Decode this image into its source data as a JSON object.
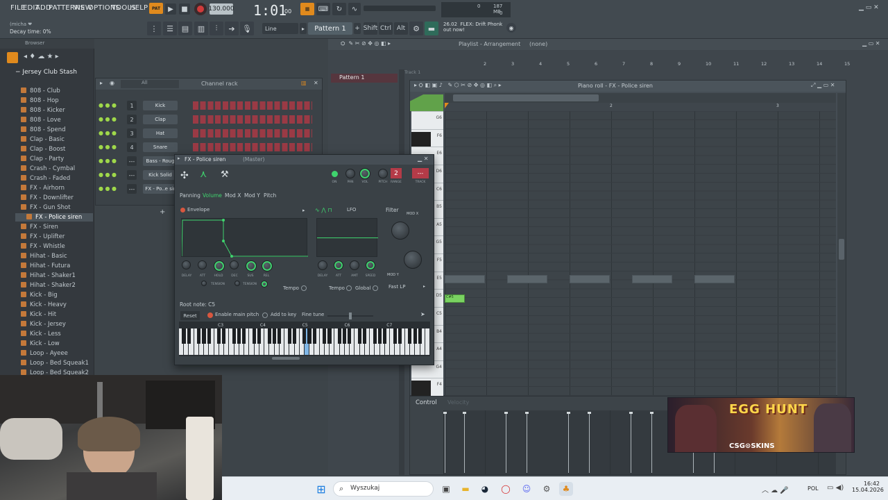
{
  "menu": [
    "FILE",
    "EDIT",
    "ADD",
    "PATTERNS",
    "VIEW",
    "OPTIONS",
    "TOOLS",
    "HELP"
  ],
  "transport": {
    "mode": "PAT",
    "tempo": "130.000",
    "time": "1:01",
    "time_sub": "00",
    "time_label": "B:S:T"
  },
  "hint": {
    "line1": "(micha ❤",
    "line2": "Decay time: 0%"
  },
  "snap": "Line",
  "pattern": "Pattern 1",
  "keys": {
    "shift": "Shift",
    "ctrl": "Ctrl",
    "alt": "Alt"
  },
  "news": {
    "date": "26.02",
    "text": "FLEX: Drift Phonk",
    "sub": "out now!"
  },
  "cpu": {
    "val": "0",
    "mem": "187 MB",
    "poly": "0"
  },
  "browser": {
    "title": "Browser",
    "root": "Jersey Club Stash",
    "items": [
      "808 - Club",
      "808 - Hop",
      "808 - Kicker",
      "808 - Love",
      "808 - Spend",
      "Clap - Basic",
      "Clap - Boost",
      "Clap - Party",
      "Crash - Cymbal",
      "Crash - Faded",
      "FX - Airhorn",
      "FX - Downlifter",
      "FX - Gun Shot",
      "FX - Police siren",
      "FX - Siren",
      "FX - Uplifter",
      "FX - Whistle",
      "Hihat - Basic",
      "Hihat - Futura",
      "Hihat - Shaker1",
      "Hihat - Shaker2",
      "Kick - Big",
      "Kick - Heavy",
      "Kick - Hit",
      "Kick - Jersey",
      "Kick - Less",
      "Kick - Low",
      "Loop - Ayeee",
      "Loop - Bed Squeak1",
      "Loop - Bed Squeak2"
    ],
    "selected": "FX - Police siren"
  },
  "channel_rack": {
    "title": "Channel rack",
    "filter": "All",
    "channels": [
      {
        "num": "1",
        "name": "Kick"
      },
      {
        "num": "2",
        "name": "Clap"
      },
      {
        "num": "3",
        "name": "Hat"
      },
      {
        "num": "4",
        "name": "Snare"
      },
      {
        "num": "---",
        "name": "Bass - Roug"
      },
      {
        "num": "---",
        "name": "Kick Solid"
      },
      {
        "num": "---",
        "name": "FX - Po..e sir"
      }
    ]
  },
  "playlist": {
    "title": "Playlist - Arrangement",
    "sel": "(none)",
    "pattern_item": "Pattern 1",
    "track": "Track 1",
    "bars": [
      "2",
      "3",
      "4",
      "5",
      "6",
      "7",
      "8",
      "9",
      "10",
      "11",
      "12",
      "13",
      "14",
      "15"
    ]
  },
  "piano_roll": {
    "title": "Piano roll - FX - Police siren",
    "notes": [
      "G6",
      "F6",
      "E6",
      "D6",
      "C6",
      "B5",
      "A5",
      "G5",
      "F5",
      "E5",
      "D5",
      "C5",
      "B4",
      "A4",
      "G4",
      "F4"
    ],
    "note_label": "C#5",
    "control": "Control",
    "control_sub": "Velocity",
    "bar2": "2",
    "bar3": "3"
  },
  "fx": {
    "title": "FX - Police siren",
    "sub": "(Master)",
    "channel_num": "2",
    "labels": {
      "on": "ON",
      "pan": "PAN",
      "vol": "VOL",
      "pitch": "PITCH",
      "range": "RANGE",
      "track": "TRACK"
    },
    "tabs": [
      "Panning",
      "Volume",
      "Mod X",
      "Mod Y",
      "Pitch"
    ],
    "active_tab": "Volume",
    "envelope": "Envelope",
    "lfo": "LFO",
    "filter": "Filter",
    "modx": "MOD X",
    "mody": "MOD Y",
    "env_knobs": [
      "DELAY",
      "ATT",
      "HOLD",
      "DEC",
      "SUS",
      "REL"
    ],
    "lfo_knobs": [
      "DELAY",
      "ATT",
      "AMT",
      "SPEED"
    ],
    "tension": "TENSION",
    "tempo": "Tempo",
    "global": "Global",
    "filter_type": "Fast LP",
    "root_note": "Root note: C5",
    "reset": "Reset",
    "main_pitch": "Enable main pitch",
    "add_key": "Add to key",
    "fine_tune": "Fine tune",
    "octaves": [
      "C3",
      "C4",
      "C5",
      "C6",
      "C7"
    ]
  },
  "ad": {
    "title": "EGG HUNT",
    "brand": "CSG⊙SKINS"
  },
  "taskbar": {
    "search": "Wyszukaj",
    "lang": "POL",
    "time": "16:42",
    "date": "15.04.2026"
  }
}
